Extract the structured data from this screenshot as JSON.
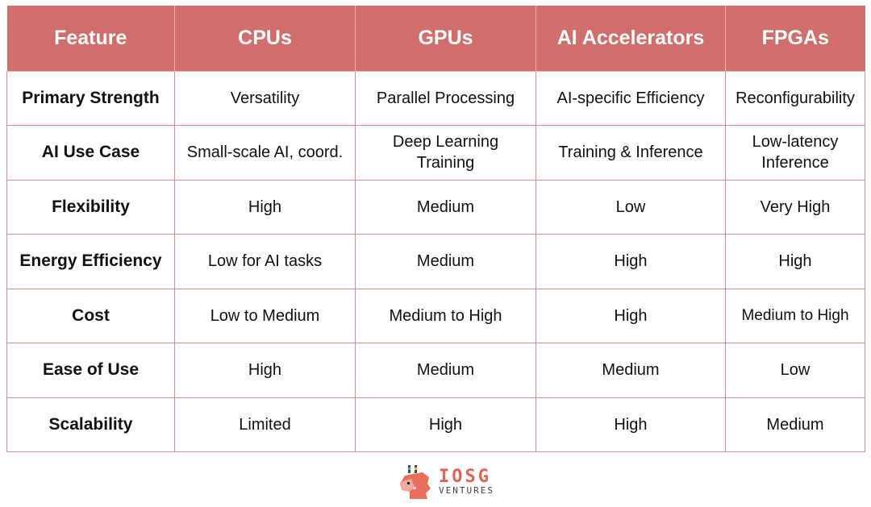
{
  "table": {
    "headers": [
      "Feature",
      "CPUs",
      "GPUs",
      "AI Accelerators",
      "FPGAs"
    ],
    "rows": [
      [
        "Primary Strength",
        "Versatility",
        "Parallel Processing",
        "AI-specific Efficiency",
        "Reconfigurability"
      ],
      [
        "AI Use Case",
        "Small-scale AI, coord.",
        "Deep Learning Training",
        "Training & Inference",
        "Low-latency Inference"
      ],
      [
        "Flexibility",
        "High",
        "Medium",
        "Low",
        "Very High"
      ],
      [
        "Energy Efficiency",
        "Low for AI tasks",
        "Medium",
        "High",
        "High"
      ],
      [
        "Cost",
        "Low to Medium",
        "Medium to High",
        "High",
        "Medium to High"
      ],
      [
        "Ease of Use",
        "High",
        "Medium",
        "Medium",
        "Low"
      ],
      [
        "Scalability",
        "Limited",
        "High",
        "High",
        "Medium"
      ]
    ]
  },
  "colors": {
    "header_bg": "#d06e6c",
    "header_text": "#ffffff",
    "grid": "#e08a8a",
    "brand": "#e0635a"
  },
  "logo": {
    "icon": "dragon-mascot-icon",
    "brand": "IOSG",
    "subtitle": "VENTURES"
  }
}
